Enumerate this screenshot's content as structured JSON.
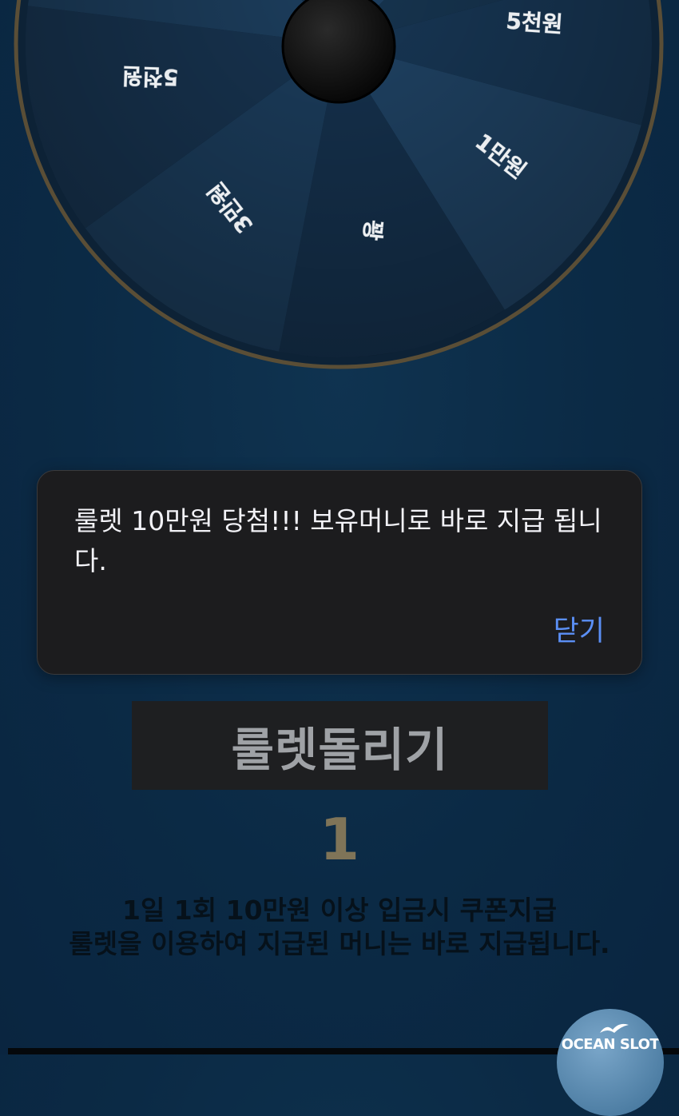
{
  "wheel": {
    "labels": [
      "5천원",
      "1만원",
      "꽝",
      "3만원",
      "5천원"
    ]
  },
  "alert": {
    "message": "룰렛 10만원 당첨!!! 보유머니로 바로 지급 됩니다.",
    "close_label": "닫기"
  },
  "spin_button": {
    "label": "룰렛돌리기"
  },
  "spin_count": "1",
  "info": {
    "line1": "1일 1회 10만원 이상 입금시 쿠폰지급",
    "line2": "룰렛을 이용하여 지급된 머니는 바로 지급됩니다."
  },
  "logo": {
    "text": "OCEAN SLOT",
    "icon": "seagull-icon"
  },
  "colors": {
    "background": "#0b2a45",
    "alert_bg": "#1c1c1e",
    "alert_link": "#5b8ff5",
    "spin_button_bg": "#1e1f21",
    "count": "#7f7458"
  }
}
